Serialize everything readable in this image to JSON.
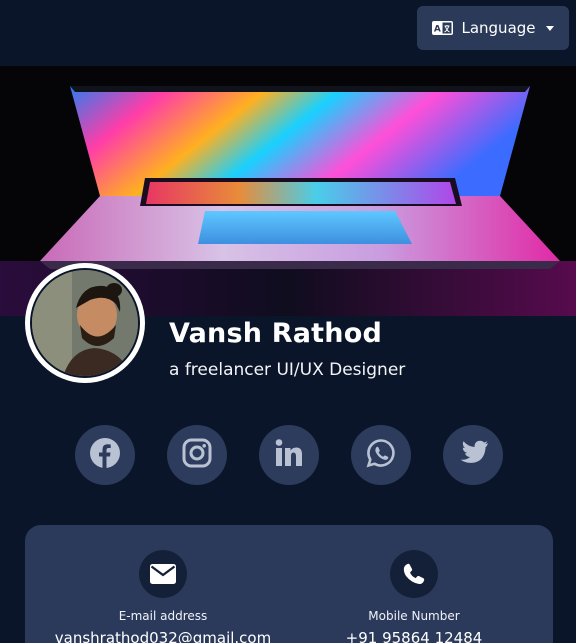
{
  "header": {
    "language_button": {
      "label": "Language",
      "icon": "translate-icon"
    }
  },
  "profile": {
    "cover_image": "laptop-cover-image",
    "avatar": "profile-photo",
    "name": "Vansh Rathod",
    "tagline": "a freelancer UI/UX Designer"
  },
  "social": [
    {
      "icon": "facebook-icon"
    },
    {
      "icon": "instagram-icon"
    },
    {
      "icon": "linkedin-icon"
    },
    {
      "icon": "whatsapp-icon"
    },
    {
      "icon": "twitter-icon"
    }
  ],
  "contact": {
    "email": {
      "label": "E-mail address",
      "value": "vanshrathod032@gmail.com",
      "icon": "envelope-icon"
    },
    "phone": {
      "label": "Mobile Number",
      "value": "+91 95864 12484",
      "icon": "phone-icon"
    }
  },
  "colors": {
    "background": "#0b1529",
    "surface": "#2b3a5b",
    "social_circle": "#2d3c5c",
    "icon": "#b9c2d3"
  }
}
